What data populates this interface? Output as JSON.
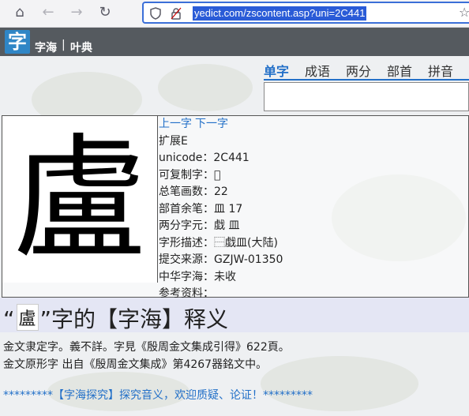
{
  "browser": {
    "url": "yedict.com/zscontent.asp?uni=2C441",
    "icons": [
      "home-icon",
      "back-icon",
      "forward-icon",
      "reload-icon",
      "shield-icon",
      "lock-icon",
      "star-icon"
    ]
  },
  "site": {
    "logo_char": "字",
    "name": "字海",
    "separator": "|",
    "subtitle": "叶典"
  },
  "search": {
    "tabs": [
      {
        "label": "单字",
        "active": true
      },
      {
        "label": "成语",
        "active": false
      },
      {
        "label": "两分",
        "active": false
      },
      {
        "label": "部首",
        "active": false
      },
      {
        "label": "拼音",
        "active": false
      }
    ],
    "value": ""
  },
  "character": {
    "glyph": "盧",
    "prev_link": "上一字",
    "next_link": "下一字",
    "lines": [
      "扩展E",
      "unicode：2C441",
      "可复制字：𬑁",
      "总笔画数：22",
      "部首余笔：皿 17",
      "两分字元：戱 皿",
      "字形描述：⿱戱皿(大陆)",
      "提交来源：GZJW-01350",
      "中华字海：未收",
      "参考资料："
    ]
  },
  "definition": {
    "title_prefix": "“",
    "title_char": "盧",
    "title_suffix": "”字的【字海】释义",
    "paragraphs": [
      "金文隶定字。義不詳。字見《殷周金文集成引得》622頁。",
      "金文原形字 出自《殷周金文集成》第4267器銘文中。"
    ],
    "probe_link": "*********【字海探究】探究音义，欢迎质疑、论证！*********"
  },
  "colors": {
    "accent": "#2370c8",
    "header_bg": "#555a5f",
    "band_bg": "#e4e6f4"
  }
}
